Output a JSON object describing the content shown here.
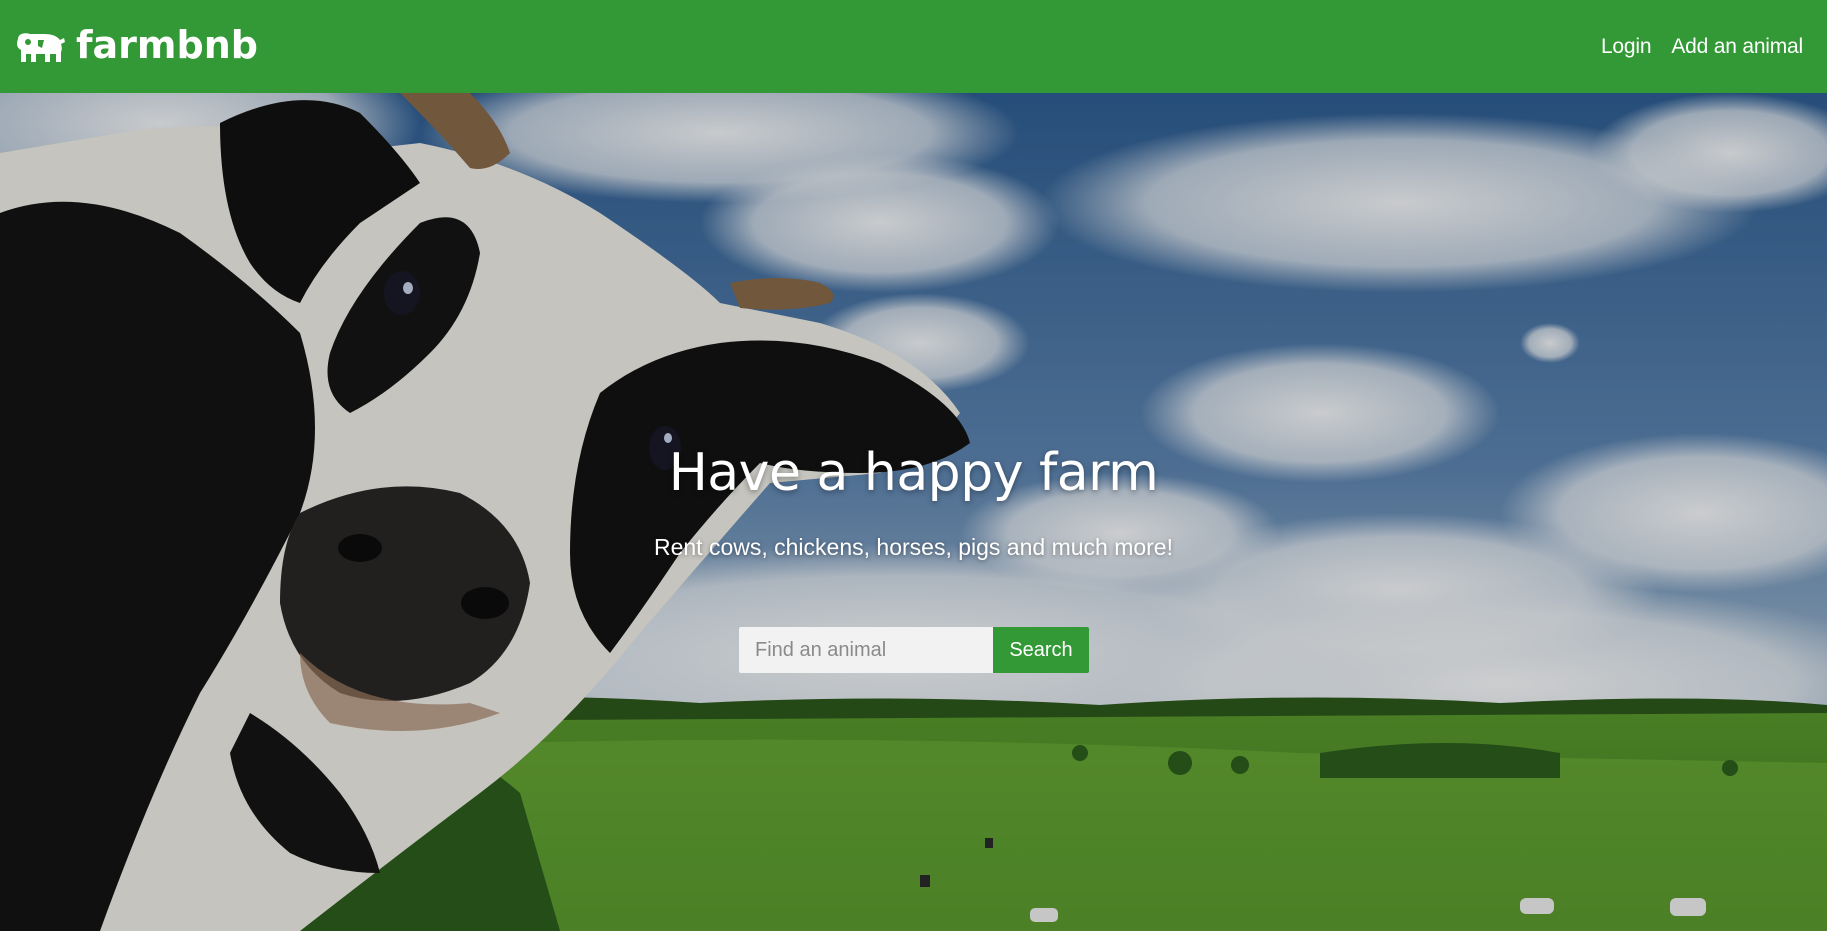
{
  "navbar": {
    "brand_name": "farmbnb",
    "brand_icon": "cow-icon",
    "links": [
      {
        "label": "Login"
      },
      {
        "label": "Add an animal"
      }
    ],
    "background_color": "#339936"
  },
  "hero": {
    "title": "Have a happy farm",
    "subtitle": "Rent cows, chickens, horses, pigs and much more!",
    "search": {
      "placeholder": "Find an animal",
      "value": "",
      "button_label": "Search"
    },
    "background_image": "cow-in-pasture-photo"
  },
  "colors": {
    "accent": "#339936",
    "text_on_accent": "#ffffff"
  }
}
